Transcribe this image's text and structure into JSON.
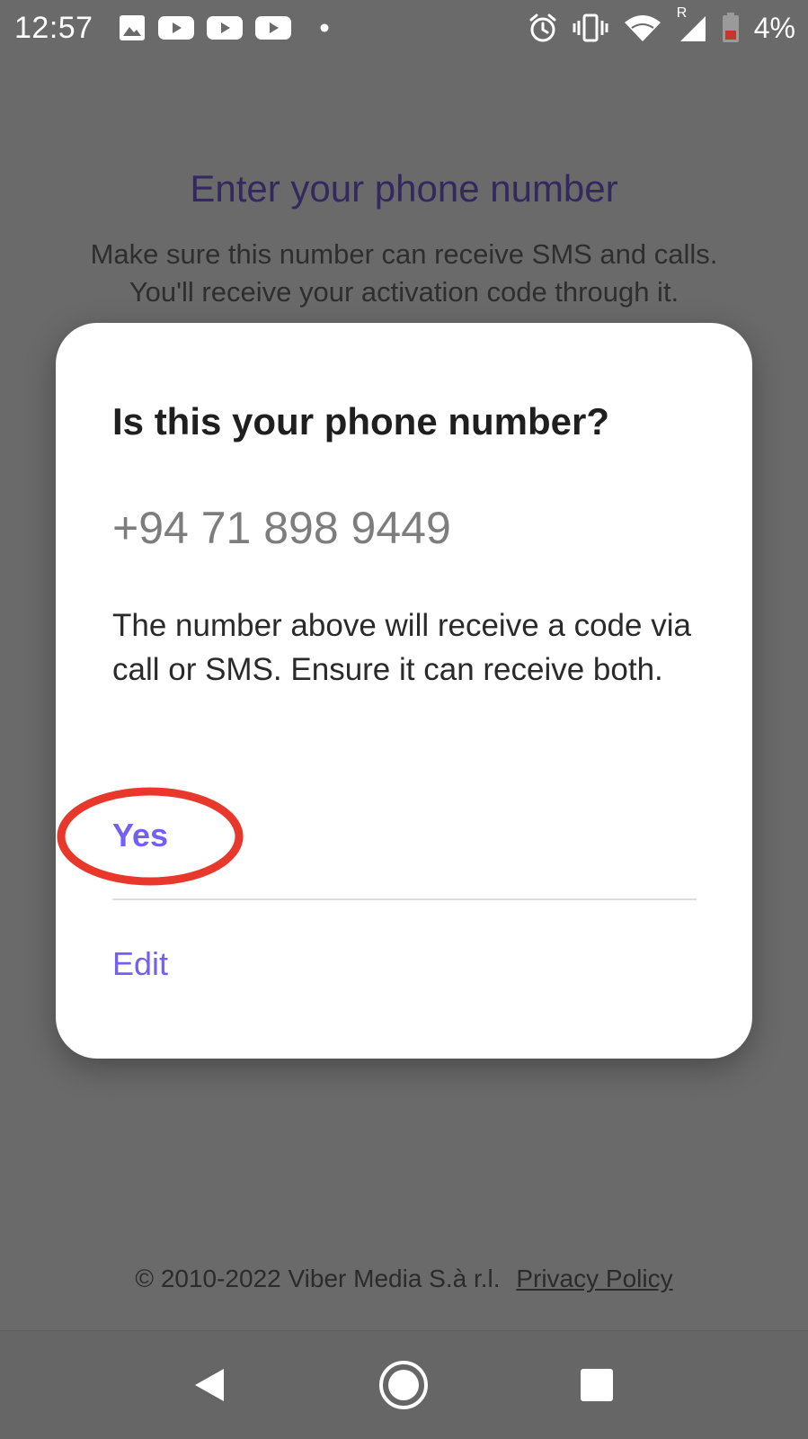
{
  "status_bar": {
    "time": "12:57",
    "notification_icons": [
      "gallery-icon",
      "youtube-icon",
      "youtube-icon",
      "youtube-icon",
      "dot-icon"
    ],
    "system_icons": [
      "alarm-icon",
      "vibrate-icon",
      "wifi-icon",
      "roaming-signal-icon",
      "battery-low-icon"
    ],
    "roaming_indicator": "R",
    "battery_percent": "4%"
  },
  "background": {
    "title": "Enter your phone number",
    "subtitle_line1": "Make sure this number can receive SMS and calls.",
    "subtitle_line2": "You'll receive your activation code through it.",
    "footer_text": "© 2010-2022 Viber Media S.à r.l.",
    "footer_link": "Privacy Policy"
  },
  "dialog": {
    "title": "Is this your phone number?",
    "phone_number": "+94 71 898 9449",
    "body": "The number above will receive a code via call or SMS. Ensure it can receive both.",
    "yes_label": "Yes",
    "edit_label": "Edit"
  },
  "nav_bar": {
    "buttons": [
      "back-icon",
      "home-icon",
      "recents-icon"
    ]
  },
  "colors": {
    "accent": "#7360f2",
    "highlight": "#e8382b",
    "scrim_background": "#6a6a6a",
    "dialog_background": "#ffffff",
    "battery_low": "#c0392b"
  }
}
